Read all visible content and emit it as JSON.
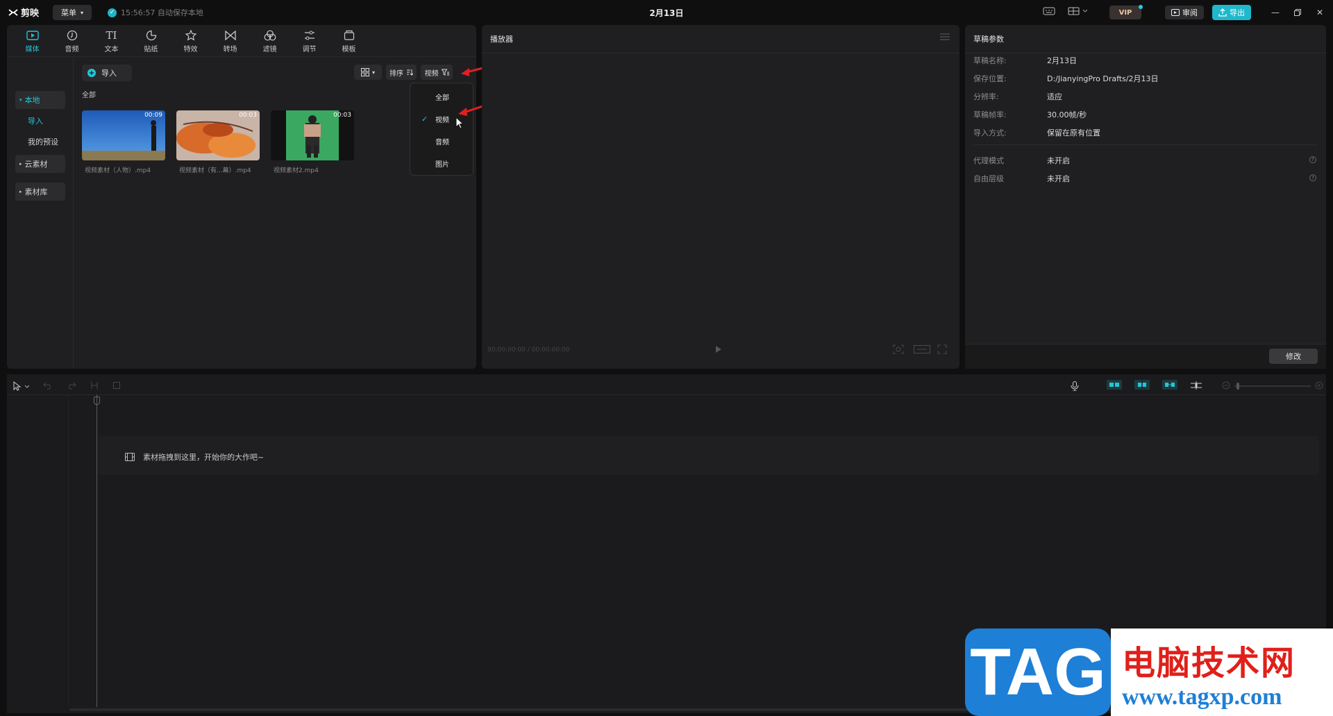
{
  "topbar": {
    "app_name": "剪映",
    "menu_label": "菜单",
    "autosave_text": "15:56:57 自动保存本地",
    "project_title": "2月13日",
    "vip_label": "VIP",
    "review_label": "审阅",
    "export_label": "导出"
  },
  "media_tabs": [
    {
      "label": "媒体",
      "icon": "media-icon",
      "active": true
    },
    {
      "label": "音频",
      "icon": "audio-icon"
    },
    {
      "label": "文本",
      "icon": "text-icon"
    },
    {
      "label": "贴纸",
      "icon": "sticker-icon"
    },
    {
      "label": "特效",
      "icon": "effects-icon"
    },
    {
      "label": "转场",
      "icon": "transition-icon"
    },
    {
      "label": "滤镜",
      "icon": "filter-icon"
    },
    {
      "label": "调节",
      "icon": "adjust-icon"
    },
    {
      "label": "模板",
      "icon": "template-icon"
    }
  ],
  "media_sidebar": {
    "local": "本地",
    "import": "导入",
    "my_presets": "我的预设",
    "cloud": "云素材",
    "library": "素材库"
  },
  "media_toolbar": {
    "import_label": "导入",
    "sort_label": "排序",
    "filter_label": "视频",
    "section_label": "全部"
  },
  "media_items": [
    {
      "duration": "00:09",
      "name": "视频素材（人物）.mp4"
    },
    {
      "duration": "00:03",
      "name": "视频素材（有...幕）.mp4"
    },
    {
      "duration": "00:03",
      "name": "视频素材2.mp4"
    }
  ],
  "filter_dropdown": {
    "options": [
      "全部",
      "视频",
      "音频",
      "图片"
    ],
    "selected": "视频"
  },
  "player": {
    "title": "播放器",
    "timecode": "00:00:00:00 / 00:00:00:00"
  },
  "params": {
    "title": "草稿参数",
    "rows": [
      {
        "label": "草稿名称:",
        "value": "2月13日"
      },
      {
        "label": "保存位置:",
        "value": "D:/JianyingPro Drafts/2月13日"
      },
      {
        "label": "分辨率:",
        "value": "适应"
      },
      {
        "label": "草稿帧率:",
        "value": "30.00帧/秒"
      },
      {
        "label": "导入方式:",
        "value": "保留在原有位置"
      }
    ],
    "rows2": [
      {
        "label": "代理模式",
        "value": "未开启"
      },
      {
        "label": "自由层级",
        "value": "未开启"
      }
    ],
    "modify_label": "修改"
  },
  "timeline": {
    "drop_hint": "素材拖拽到这里，开始你的大作吧~"
  },
  "watermark": {
    "tag": "TAG",
    "cn": "电脑技术网",
    "url": "www.tagxp.com"
  },
  "colors": {
    "accent": "#23c5d8",
    "export": "#1fb8cc",
    "arrow": "#e02020"
  }
}
